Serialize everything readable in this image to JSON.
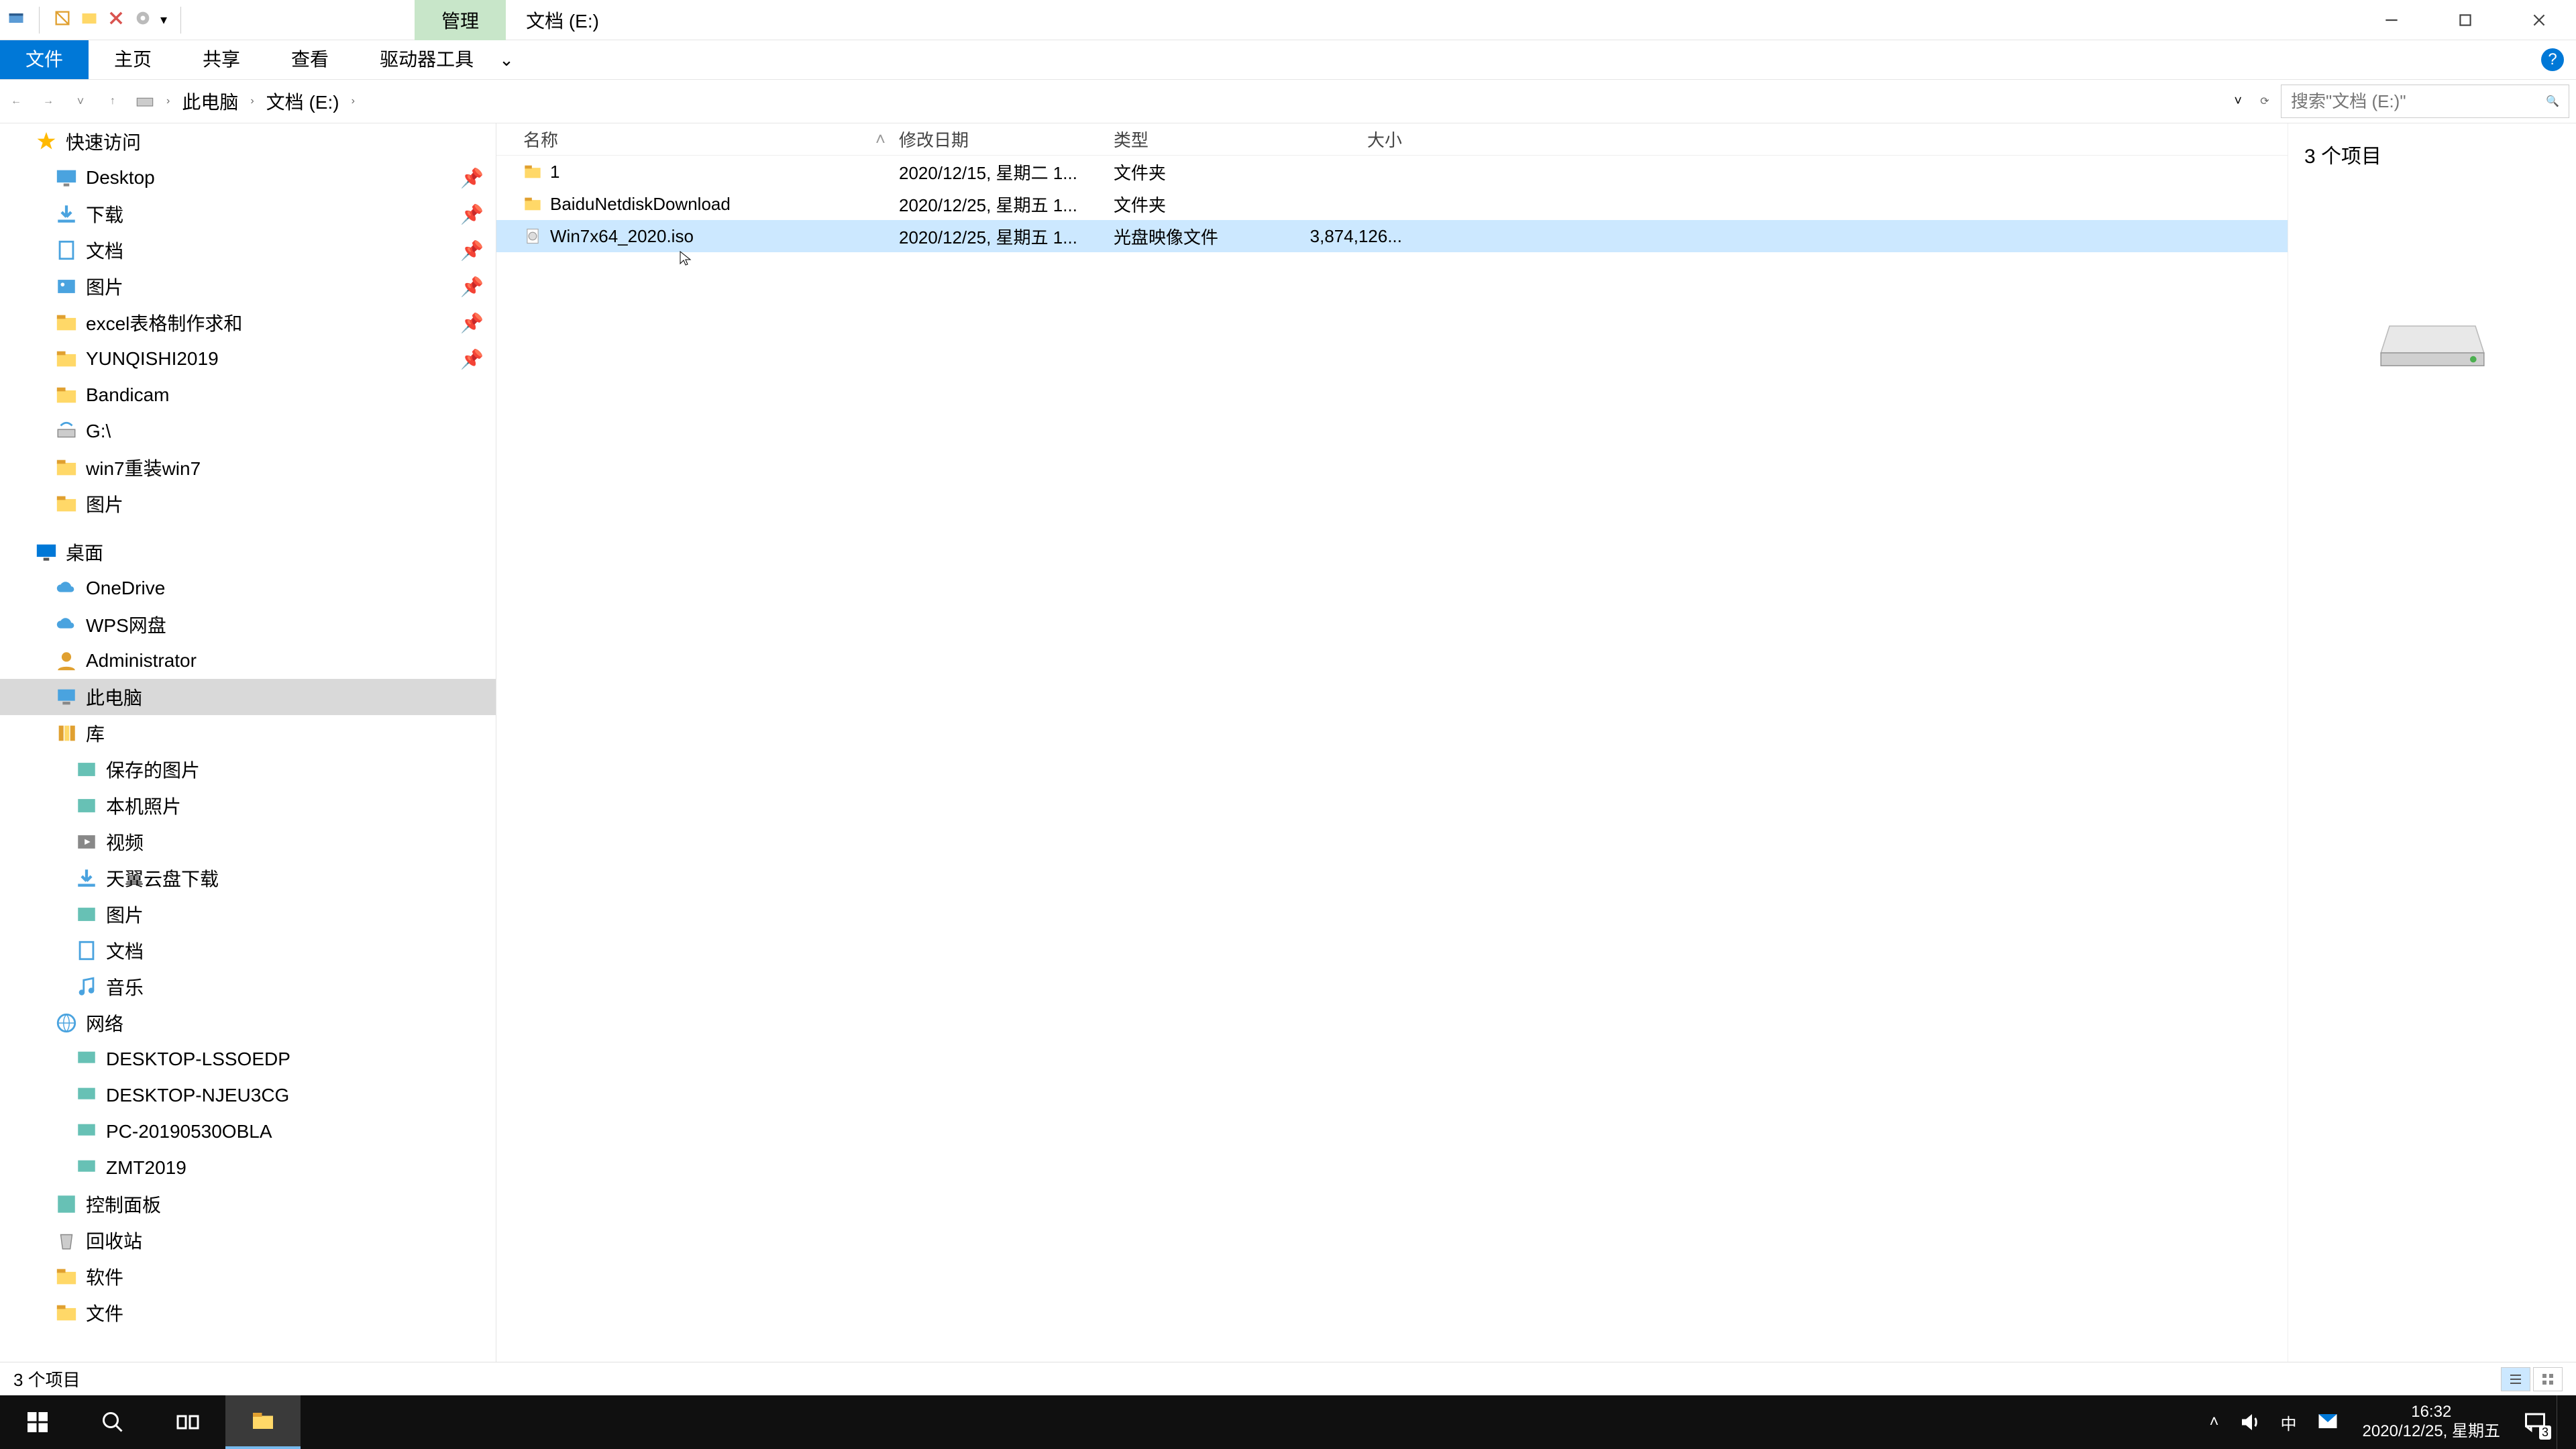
{
  "title": {
    "ribbon_context": "管理",
    "window": "文档 (E:)"
  },
  "ribbon": {
    "file": "文件",
    "home": "主页",
    "share": "共享",
    "view": "查看",
    "drivetools": "驱动器工具"
  },
  "addr": {
    "back": "←",
    "fwd": "→",
    "up": "↑",
    "segs": [
      "此电脑",
      "文档 (E:)"
    ],
    "search_placeholder": "搜索\"文档 (E:)\"",
    "refresh": "⟳"
  },
  "sidebar_groups": [
    {
      "label": "快速访问",
      "key": "quick",
      "level": 1,
      "icon": "star",
      "items": [
        {
          "label": "Desktop",
          "icon": "desktop",
          "pinned": true
        },
        {
          "label": "下载",
          "icon": "download",
          "pinned": true
        },
        {
          "label": "文档",
          "icon": "doc",
          "pinned": true
        },
        {
          "label": "图片",
          "icon": "pic",
          "pinned": true
        },
        {
          "label": "excel表格制作求和",
          "icon": "folder",
          "pinned": true
        },
        {
          "label": "YUNQISHI2019",
          "icon": "folder",
          "pinned": true
        },
        {
          "label": "Bandicam",
          "icon": "folder"
        },
        {
          "label": "G:\\",
          "icon": "drive-net"
        },
        {
          "label": "win7重装win7",
          "icon": "folder"
        },
        {
          "label": "图片",
          "icon": "folder"
        }
      ]
    },
    {
      "label": "桌面",
      "key": "desktop-root",
      "level": 1,
      "icon": "desktop-blue",
      "items": [
        {
          "label": "OneDrive",
          "icon": "cloud"
        },
        {
          "label": "WPS网盘",
          "icon": "cloud"
        },
        {
          "label": "Administrator",
          "icon": "user"
        },
        {
          "label": "此电脑",
          "icon": "pc",
          "selected": true
        },
        {
          "label": "库",
          "icon": "lib",
          "sub": [
            {
              "label": "保存的图片",
              "icon": "pic-sm"
            },
            {
              "label": "本机照片",
              "icon": "pic-sm"
            },
            {
              "label": "视频",
              "icon": "video"
            },
            {
              "label": "天翼云盘下载",
              "icon": "download"
            },
            {
              "label": "图片",
              "icon": "pic-sm"
            },
            {
              "label": "文档",
              "icon": "doc"
            },
            {
              "label": "音乐",
              "icon": "music"
            }
          ]
        },
        {
          "label": "网络",
          "icon": "network",
          "sub": [
            {
              "label": "DESKTOP-LSSOEDP",
              "icon": "pc-sm"
            },
            {
              "label": "DESKTOP-NJEU3CG",
              "icon": "pc-sm"
            },
            {
              "label": "PC-20190530OBLA",
              "icon": "pc-sm"
            },
            {
              "label": "ZMT2019",
              "icon": "pc-sm"
            }
          ]
        },
        {
          "label": "控制面板",
          "icon": "ctrl"
        },
        {
          "label": "回收站",
          "icon": "bin"
        },
        {
          "label": "软件",
          "icon": "folder"
        },
        {
          "label": "文件",
          "icon": "folder"
        }
      ]
    }
  ],
  "columns": {
    "name": "名称",
    "date": "修改日期",
    "type": "类型",
    "size": "大小"
  },
  "files": [
    {
      "name": "1",
      "date": "2020/12/15, 星期二 1...",
      "type": "文件夹",
      "size": "",
      "icon": "folder"
    },
    {
      "name": "BaiduNetdiskDownload",
      "date": "2020/12/25, 星期五 1...",
      "type": "文件夹",
      "size": "",
      "icon": "folder"
    },
    {
      "name": "Win7x64_2020.iso",
      "date": "2020/12/25, 星期五 1...",
      "type": "光盘映像文件",
      "size": "3,874,126...",
      "icon": "iso",
      "selected": true
    }
  ],
  "preview": {
    "count": "3 个项目"
  },
  "status": {
    "text": "3 个项目"
  },
  "taskbar": {
    "time": "16:32",
    "date": "2020/12/25, 星期五",
    "ime": "中",
    "notif_count": "3"
  }
}
